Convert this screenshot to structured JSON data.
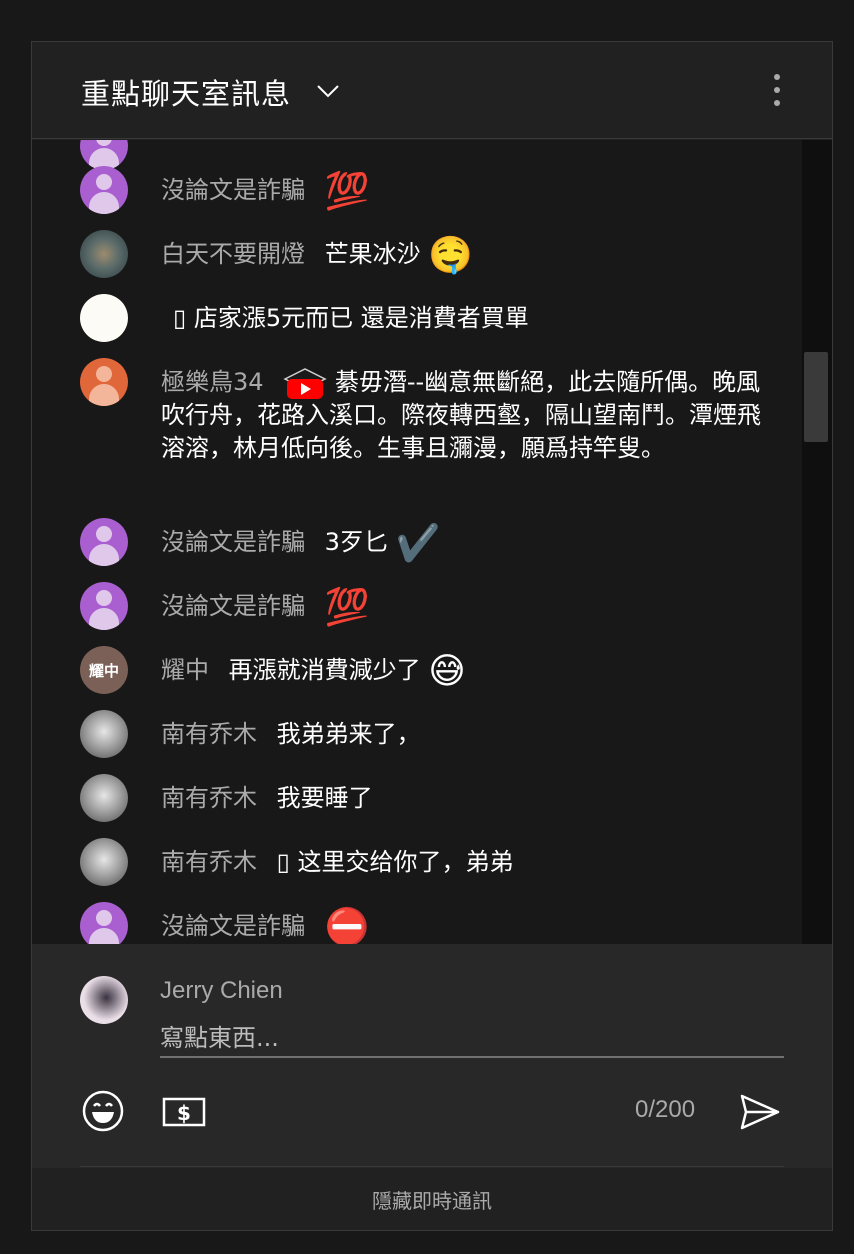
{
  "header": {
    "title": "重點聊天室訊息",
    "dropdown_icon": "chevron-down-icon",
    "menu_icon": "kebab-menu-icon"
  },
  "messages": [
    {
      "author": "沒論文是詐騙",
      "text": "",
      "emoji": "💯",
      "avatar": "purple"
    },
    {
      "author": "白天不要開燈",
      "text": "芒果冰沙",
      "emoji": "🤤",
      "avatar": "blur"
    },
    {
      "author": "",
      "text": "▯ 店家漲5元而已 還是消費者買單",
      "emoji": "",
      "avatar": "white"
    },
    {
      "author": "極樂鳥34",
      "text": "綦毋潛--幽意無斷絕，此去隨所偶。晚風吹行舟，花路入溪口。際夜轉西壑，隔山望南鬥。潭煙飛溶溶，林月低向後。生事且瀰漫，願爲持竿叟。",
      "emoji": "",
      "avatar": "orange"
    },
    {
      "author": "沒論文是詐騙",
      "text": "3歹匕",
      "emoji": "✔️",
      "avatar": "purple"
    },
    {
      "author": "沒論文是詐騙",
      "text": "",
      "emoji": "💯",
      "avatar": "purple"
    },
    {
      "author": "耀中",
      "text": "再漲就消費減少了",
      "emoji": "😅",
      "avatar": "text",
      "avatar_text": "耀中"
    },
    {
      "author": "南有乔木",
      "text": "我弟弟来了，",
      "emoji": "",
      "avatar": "tree"
    },
    {
      "author": "南有乔木",
      "text": "我要睡了",
      "emoji": "",
      "avatar": "tree"
    },
    {
      "author": "南有乔木",
      "text": "▯ 这里交给你了，弟弟",
      "emoji": "",
      "avatar": "tree"
    },
    {
      "author": "沒論文是詐騙",
      "text": "",
      "emoji": "⛔",
      "avatar": "purple"
    }
  ],
  "composer": {
    "user_name": "Jerry Chien",
    "placeholder": "寫點東西...",
    "value": "",
    "counter": "0/200"
  },
  "footer": {
    "label": "隱藏即時通訊"
  },
  "colors": {
    "accent": "#3e8ff0",
    "background": "#181818",
    "panel": "#212121",
    "author_text": "#aaaaaa"
  }
}
